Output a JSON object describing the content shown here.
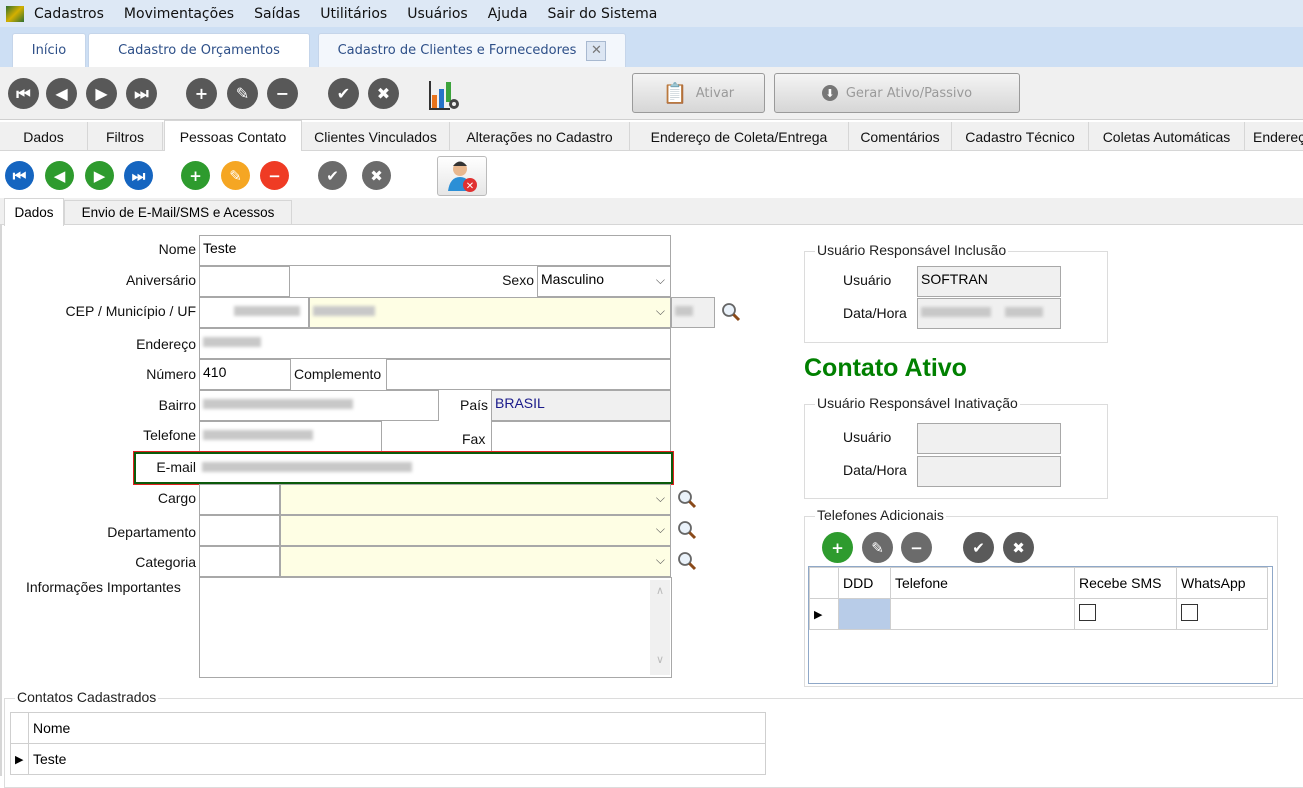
{
  "menu": {
    "items": [
      "Cadastros",
      "Movimentações",
      "Saídas",
      "Utilitários",
      "Usuários",
      "Ajuda",
      "Sair do Sistema"
    ]
  },
  "window_tabs": [
    {
      "label": "Início"
    },
    {
      "label": "Cadastro de Orçamentos"
    },
    {
      "label": "Cadastro de Clientes e Fornecedores",
      "active": true
    }
  ],
  "toolbar": {
    "ativar_label": "Ativar",
    "gerar_label": "Gerar Ativo/Passivo"
  },
  "subtabs": [
    "Dados",
    "Filtros",
    "Pessoas Contato",
    "Clientes Vinculados",
    "Alterações no Cadastro",
    "Endereço de Coleta/Entrega",
    "Comentários",
    "Cadastro Técnico",
    "Coletas Automáticas",
    "Endereço"
  ],
  "subtabs_active": "Pessoas Contato",
  "inner_tabs": [
    "Dados",
    "Envio de E-Mail/SMS e Acessos"
  ],
  "form": {
    "nome_label": "Nome",
    "nome": "Teste",
    "aniversario_label": "Aniversário",
    "aniversario": "",
    "sexo_label": "Sexo",
    "sexo": "Masculino",
    "cep_label": "CEP / Município / UF",
    "endereco_label": "Endereço",
    "numero_label": "Número",
    "numero": "410",
    "complemento_label": "Complemento",
    "complemento": "",
    "bairro_label": "Bairro",
    "pais_label": "País",
    "pais": "BRASIL",
    "telefone_label": "Telefone",
    "fax_label": "Fax",
    "fax": "",
    "email_label": "E-mail",
    "cargo_label": "Cargo",
    "departamento_label": "Departamento",
    "categoria_label": "Categoria",
    "informacoes_label": "Informações Importantes",
    "informacoes": ""
  },
  "inclusao": {
    "title": "Usuário Responsável Inclusão",
    "usuario_label": "Usuário",
    "usuario": "SOFTRAN",
    "datahora_label": "Data/Hora"
  },
  "status": {
    "text": "Contato Ativo",
    "color": "#008000"
  },
  "inativacao": {
    "title": "Usuário Responsável Inativação",
    "usuario_label": "Usuário",
    "usuario": "",
    "datahora_label": "Data/Hora",
    "datahora": ""
  },
  "telefones": {
    "title": "Telefones Adicionais",
    "columns": [
      "DDD",
      "Telefone",
      "Recebe SMS",
      "WhatsApp"
    ],
    "rows": [
      {
        "ddd": "",
        "telefone": "",
        "recebe_sms": false,
        "whatsapp": false
      }
    ]
  },
  "contatos": {
    "title": "Contatos Cadastrados",
    "columns": [
      "Nome"
    ],
    "rows": [
      {
        "nome": "Teste"
      }
    ]
  },
  "colors": {
    "nav_blue": "#1565c0",
    "nav_green": "#2e9b2e",
    "edit_orange": "#f5a623",
    "delete_red": "#ef3b24",
    "neutral_gray": "#6b6b6b",
    "email_focus": "#0b5a0b"
  }
}
